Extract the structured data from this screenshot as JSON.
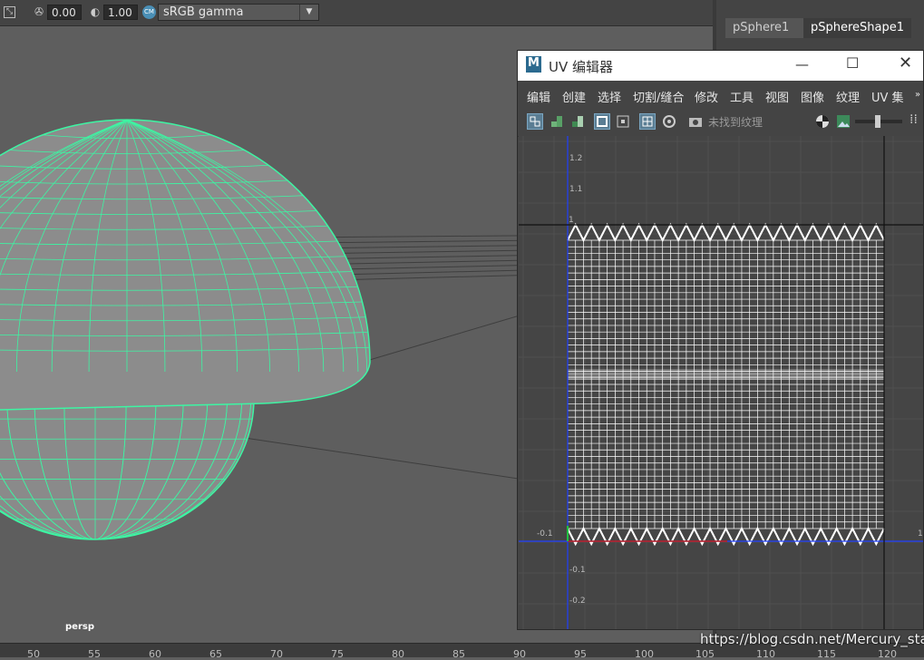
{
  "viewport_toolbar": {
    "exposure_value": "0.00",
    "gamma_value": "1.00",
    "color_mgmt_badge": "CM",
    "color_space": "sRGB gamma"
  },
  "side_panel": {
    "tabs": [
      "pSphere1",
      "pSphereShape1"
    ],
    "active_tab": "pSphereShape1"
  },
  "viewport": {
    "camera_label": "persp",
    "wireframe_color": "#3df5a3"
  },
  "timeline": {
    "ticks": [
      "50",
      "55",
      "60",
      "65",
      "70",
      "75",
      "80",
      "85",
      "90",
      "95",
      "100",
      "105",
      "110",
      "115",
      "120"
    ]
  },
  "uv_editor": {
    "title": "UV 编辑器",
    "logo": "M",
    "menu": [
      "编辑",
      "创建",
      "选择",
      "切割/缝合",
      "修改",
      "工具",
      "视图",
      "图像",
      "纹理",
      "UV 集"
    ],
    "texture_status": "未找到纹理",
    "axis_labels": {
      "v": [
        "1.2",
        "1.1",
        "1",
        "-0.1",
        "-0.2"
      ],
      "u": [
        "-0.1",
        "1"
      ]
    },
    "v_axis_color": "#1f3fff",
    "u_axis_color": "#1f3fff",
    "uv_mesh_color": "#ffffff"
  },
  "watermark": "https://blog.csdn.net/Mercury_star"
}
